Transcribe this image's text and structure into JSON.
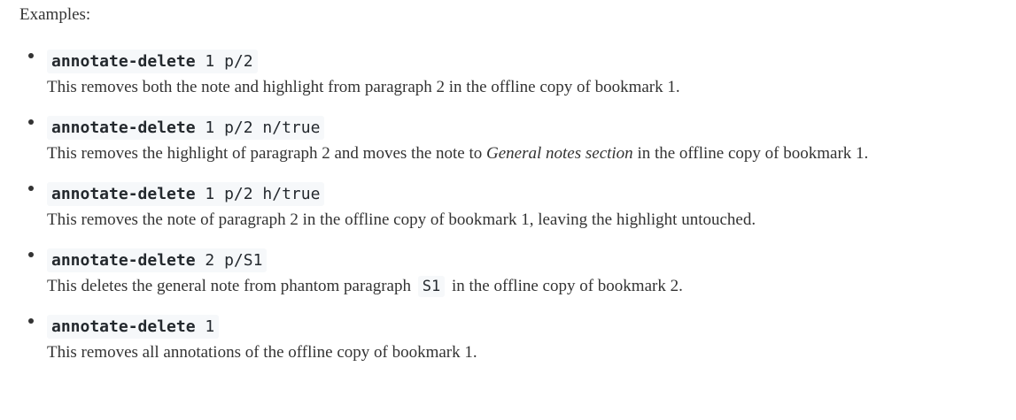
{
  "intro": "Examples:",
  "examples": [
    {
      "command_name": "annotate-delete",
      "command_args": " 1 p/2",
      "desc_before": "This removes both the note and highlight from paragraph 2 in the offline copy of bookmark 1.",
      "desc_emph": "",
      "desc_code": "",
      "desc_after": ""
    },
    {
      "command_name": "annotate-delete",
      "command_args": " 1 p/2 n/true",
      "desc_before": "This removes the highlight of paragraph 2 and moves the note to ",
      "desc_emph": "General notes section",
      "desc_code": "",
      "desc_after": " in the offline copy of bookmark 1."
    },
    {
      "command_name": "annotate-delete",
      "command_args": " 1 p/2 h/true",
      "desc_before": "This removes the note of paragraph 2 in the offline copy of bookmark 1, leaving the highlight untouched.",
      "desc_emph": "",
      "desc_code": "",
      "desc_after": ""
    },
    {
      "command_name": "annotate-delete",
      "command_args": " 2 p/S1",
      "desc_before": "This deletes the general note from phantom paragraph ",
      "desc_emph": "",
      "desc_code": "S1",
      "desc_after": " in the offline copy of bookmark 2."
    },
    {
      "command_name": "annotate-delete",
      "command_args": " 1",
      "desc_before": "This removes all annotations of the offline copy of bookmark 1.",
      "desc_emph": "",
      "desc_code": "",
      "desc_after": ""
    }
  ]
}
